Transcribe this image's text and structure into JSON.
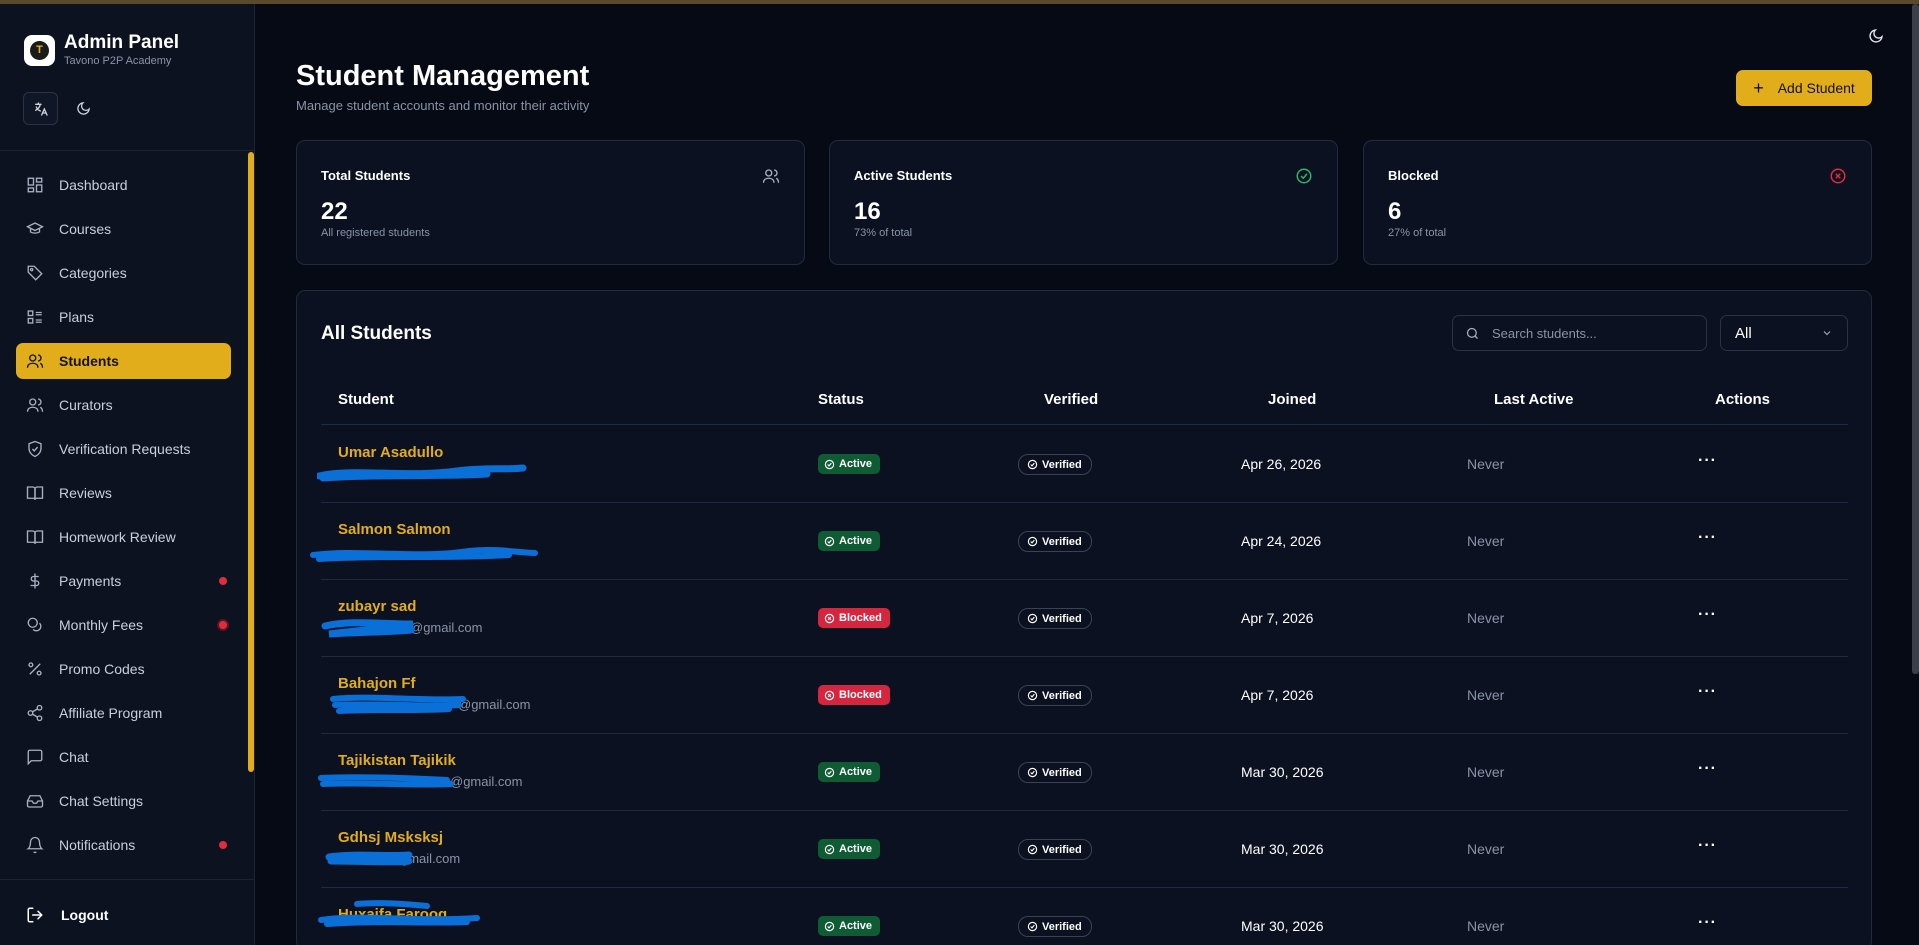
{
  "sidebar": {
    "logo_text": "T",
    "title": "Admin Panel",
    "subtitle": "Tavono P2P Academy",
    "items": [
      {
        "label": "Dashboard",
        "icon": "dashboard-icon"
      },
      {
        "label": "Courses",
        "icon": "graduation-cap-icon"
      },
      {
        "label": "Categories",
        "icon": "tag-icon"
      },
      {
        "label": "Plans",
        "icon": "list-icon"
      },
      {
        "label": "Students",
        "icon": "users-icon",
        "active": true
      },
      {
        "label": "Curators",
        "icon": "users-icon"
      },
      {
        "label": "Verification Requests",
        "icon": "shield-check-icon"
      },
      {
        "label": "Reviews",
        "icon": "book-open-icon"
      },
      {
        "label": "Homework Review",
        "icon": "book-open-icon"
      },
      {
        "label": "Payments",
        "icon": "dollar-icon",
        "badge_dot": true
      },
      {
        "label": "Monthly Fees",
        "icon": "coins-icon",
        "badge_dot": true
      },
      {
        "label": "Promo Codes",
        "icon": "percent-icon"
      },
      {
        "label": "Affiliate Program",
        "icon": "share-icon"
      },
      {
        "label": "Chat",
        "icon": "chat-icon"
      },
      {
        "label": "Chat Settings",
        "icon": "inbox-icon"
      },
      {
        "label": "Notifications",
        "icon": "bell-icon",
        "badge_dot": true
      }
    ],
    "logout_label": "Logout"
  },
  "header": {
    "title": "Student Management",
    "subtitle": "Manage student accounts and monitor their activity",
    "add_button_label": "Add Student"
  },
  "stats": [
    {
      "title": "Total Students",
      "value": "22",
      "sub": "All registered students",
      "icon": "users-icon"
    },
    {
      "title": "Active Students",
      "value": "16",
      "sub": "73% of total",
      "icon": "check-circle-icon"
    },
    {
      "title": "Blocked",
      "value": "6",
      "sub": "27% of total",
      "icon": "x-circle-icon"
    }
  ],
  "table": {
    "title": "All Students",
    "search_placeholder": "Search students...",
    "filter_value": "All",
    "columns": [
      "Student",
      "Status",
      "Verified",
      "Joined",
      "Last Active",
      "Actions"
    ],
    "rows": [
      {
        "name": "Umar Asadullo",
        "email": "",
        "status": "Active",
        "verified": "Verified",
        "joined": "Apr 26, 2026",
        "last_active": "Never",
        "actions": "···"
      },
      {
        "name": "Salmon Salmon",
        "email": "",
        "status": "Active",
        "verified": "Verified",
        "joined": "Apr 24, 2026",
        "last_active": "Never",
        "actions": "···"
      },
      {
        "name": "zubayr sad",
        "email": "@gmail.com",
        "status": "Blocked",
        "verified": "Verified",
        "joined": "Apr 7, 2026",
        "last_active": "Never",
        "actions": "···"
      },
      {
        "name": "Bahajon Ff",
        "email": "@gmail.com",
        "status": "Blocked",
        "verified": "Verified",
        "joined": "Apr 7, 2026",
        "last_active": "Never",
        "actions": "···"
      },
      {
        "name": "Tajikistan Tajikik",
        "email": "@gmail.com",
        "status": "Active",
        "verified": "Verified",
        "joined": "Mar 30, 2026",
        "last_active": "Never",
        "actions": "···"
      },
      {
        "name": "Gdhsj Msksksj",
        "email": "gmail.com",
        "status": "Active",
        "verified": "Verified",
        "joined": "Mar 30, 2026",
        "last_active": "Never",
        "actions": "···"
      },
      {
        "name": "Huxaifa Farooq",
        "email": "",
        "status": "Active",
        "verified": "Verified",
        "joined": "Mar 30, 2026",
        "last_active": "Never",
        "actions": "···"
      }
    ]
  },
  "colors": {
    "accent": "#e2ad1b",
    "background": "#050a14",
    "active_badge": "#0f5c34",
    "blocked_badge": "#d6253f",
    "redaction": "#0a6fd6"
  }
}
